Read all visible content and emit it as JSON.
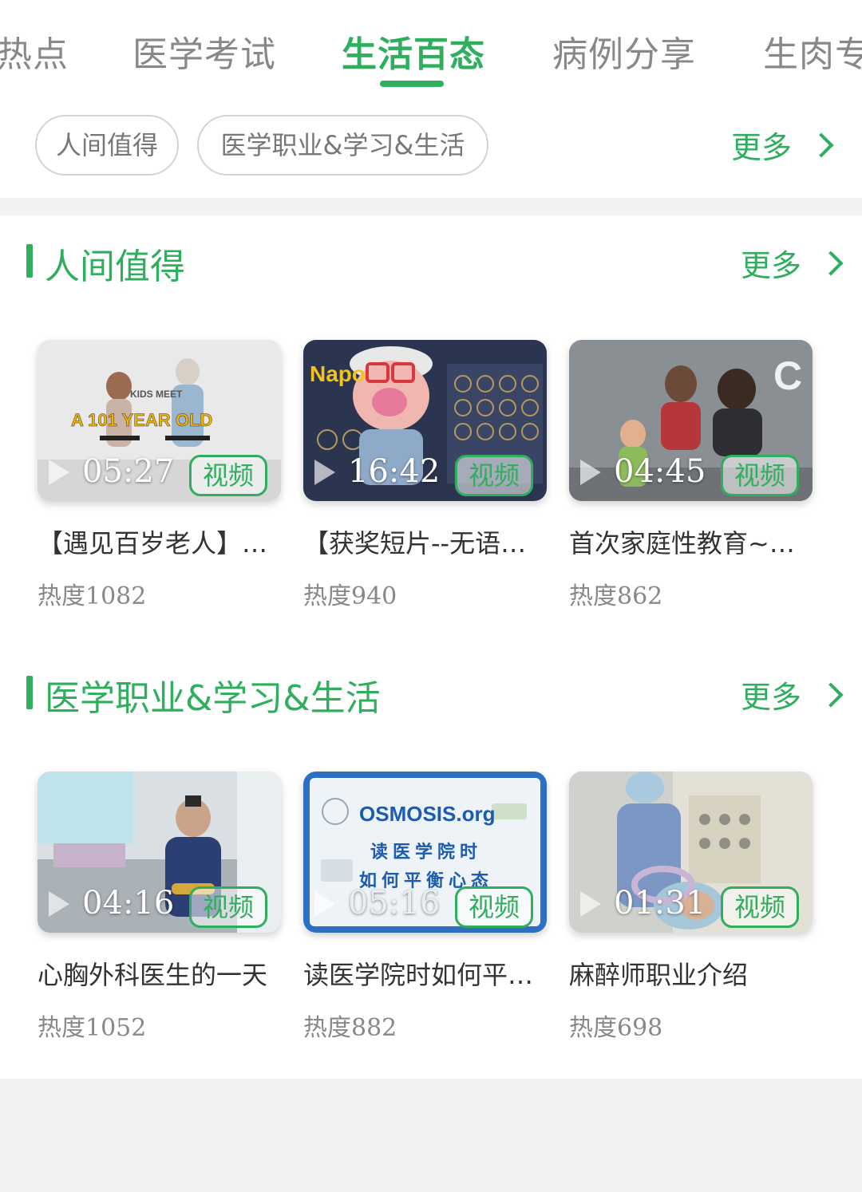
{
  "tabs": [
    {
      "label": "热点",
      "active": false
    },
    {
      "label": "医学考试",
      "active": false
    },
    {
      "label": "生活百态",
      "active": true
    },
    {
      "label": "病例分享",
      "active": false
    },
    {
      "label": "生肉专"
    }
  ],
  "chips": [
    "人间值得",
    "医学职业&学习&生活"
  ],
  "more_label": "更多",
  "sections": [
    {
      "title": "人间值得",
      "more": "更多",
      "cards": [
        {
          "duration": "05:27",
          "badge": "视频",
          "title": "【遇见百岁老人】…",
          "heat": "热度1082",
          "thumb_text": [
            "KIDS MEET",
            "A 101 YEAR OLD"
          ]
        },
        {
          "duration": "16:42",
          "badge": "视频",
          "title": "【获奖短片--无语…",
          "heat": "热度940",
          "thumb_text": [
            "Napo"
          ]
        },
        {
          "duration": "04:45",
          "badge": "视频",
          "title": "首次家庭性教育~~…",
          "heat": "热度862",
          "thumb_text": [
            "C"
          ]
        }
      ]
    },
    {
      "title": "医学职业&学习&生活",
      "more": "更多",
      "cards": [
        {
          "duration": "04:16",
          "badge": "视频",
          "title": "心胸外科医生的一天",
          "heat": "热度1052",
          "thumb_text": []
        },
        {
          "duration": "05:16",
          "badge": "视频",
          "title": "读医学院时如何平…",
          "heat": "热度882",
          "thumb_text": [
            "OSMOSIS.org",
            "读医学院时",
            "如何平衡心态"
          ]
        },
        {
          "duration": "01:31",
          "badge": "视频",
          "title": "麻醉师职业介绍",
          "heat": "热度698",
          "thumb_text": []
        }
      ]
    }
  ],
  "colors": {
    "accent": "#2fae5e",
    "muted": "#888888",
    "divider": "#f2f2f2"
  }
}
